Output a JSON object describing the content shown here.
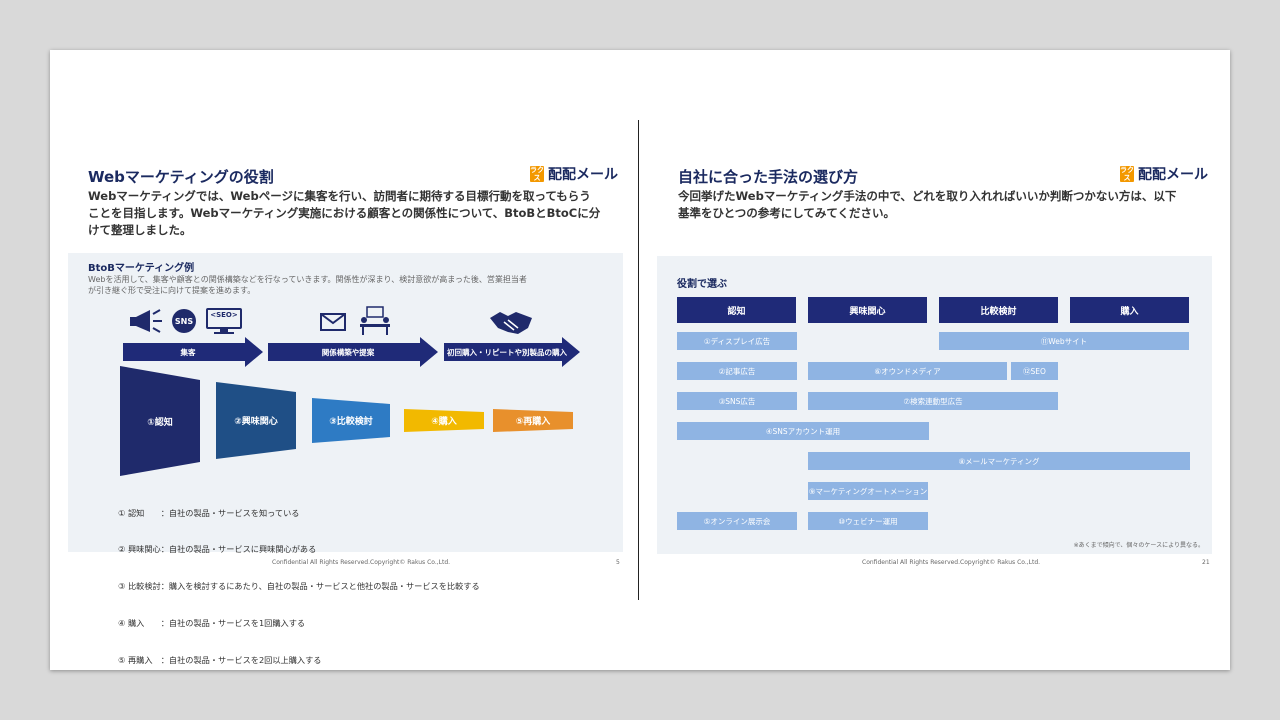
{
  "left_slide": {
    "title": "Webマーケティングの役割",
    "lead_lines": [
      "Webマーケティングでは、Webページに集客を行い、訪問者に期待する目標行動を取ってもらう",
      "ことを目指します。Webマーケティング実施における顧客との関係性について、BtoBとBtoCに分",
      "けて整理しました。"
    ],
    "logo": {
      "mark": "ラクス",
      "text": "配配メール"
    },
    "panel": {
      "subtitle": "BtoBマーケティング例",
      "desc_lines": [
        "Webを活用して、集客や顧客との関係構築などを行なっていきます。関係性が深まり、検討意欲が高まった後、営業担当者",
        "が引き継ぐ形で受注に向けて提案を進めます。"
      ],
      "icons": {
        "megaphone": "megaphone-icon",
        "sns": "SNS",
        "seo": "<SEO>",
        "mail": "mail-icon",
        "meeting": "meeting-icon",
        "handshake": "handshake-icon"
      },
      "arrows": [
        "集客",
        "関係構築や提案",
        "初回購入・リピートや別製品の購入"
      ],
      "funnel": [
        "①認知",
        "②興味関心",
        "③比較検討",
        "④購入",
        "⑤再購入"
      ],
      "funnel_colors": [
        "#1f2a6b",
        "#1f4f86",
        "#2e7bc4",
        "#f2b900",
        "#e8902c"
      ],
      "definitions": [
        "① 認知　　：自社の製品・サービスを知っている",
        "② 興味関心：自社の製品・サービスに興味関心がある",
        "③ 比較検討：購入を検討するにあたり、自社の製品・サービスと他社の製品・サービスを比較する",
        "④ 購入　　：自社の製品・サービスを1回購入する",
        "⑤ 再購入　：自社の製品・サービスを2回以上購入する"
      ]
    },
    "footer": "Confidential All Rights Reserved.Copyright© Rakus Co.,Ltd.",
    "page_number": "5"
  },
  "right_slide": {
    "title": "自社に合った手法の選び方",
    "lead_lines": [
      "今回挙げたWebマーケティング手法の中で、どれを取り入れればいいか判断つかない方は、以下",
      "基準をひとつの参考にしてみてください。"
    ],
    "logo": {
      "mark": "ラクス",
      "text": "配配メール"
    },
    "panel": {
      "subtitle": "役割で選ぶ",
      "headers": [
        "認知",
        "興味関心",
        "比較検討",
        "購入"
      ],
      "bars": [
        "①ディスプレイ広告",
        "⑪Webサイト",
        "②記事広告",
        "⑥オウンドメディア",
        "⑫SEO",
        "③SNS広告",
        "⑦検索連動型広告",
        "④SNSアカウント運用",
        "⑧メールマーケティング",
        "⑨マーケティングオートメーション",
        "⑤オンライン展示会",
        "⑩ウェビナー運用"
      ],
      "note": "※あくまで傾向で、個々のケースにより異なる。"
    },
    "footer": "Confidential All Rights Reserved.Copyright© Rakus Co.,Ltd.",
    "page_number": "21"
  },
  "colors": {
    "navy": "#1b2a60",
    "header_blue": "#1f2a78",
    "bar_blue": "#8fb4e3",
    "arrow_navy": "#1f2a78",
    "panel_bg": "#eef2f6"
  }
}
